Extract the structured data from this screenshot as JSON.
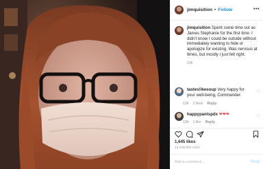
{
  "post": {
    "username": "jimquisition",
    "separator": "•",
    "follow_label": "Follow",
    "more_label": "•••",
    "caption_text": "Spent some time out as James Stephanie for the first time. I didn't know I could be outside without immediately wanting to hide or apologize for existing. Was nervous at times, but mostly I just felt right.",
    "caption_time": "13h",
    "likes": "1,645 likes",
    "posted_ago": "13 HOURS AGO"
  },
  "comments": [
    {
      "username": "tastes!ikesoup",
      "text": "Very happy for your well-being, Commander.",
      "time": "13h",
      "likes": "2 likes",
      "reply_label": "Reply",
      "hearts": ""
    },
    {
      "username": "happypantspdx",
      "text": "",
      "time": "13h",
      "likes": "1 like",
      "reply_label": "Reply",
      "hearts": "❤❤❤"
    }
  ],
  "composer": {
    "placeholder": "Add a comment...",
    "post_label": "Post"
  },
  "icons": {
    "like": "heart-icon",
    "comment": "comment-icon",
    "share": "share-icon",
    "save": "bookmark-icon"
  },
  "colors": {
    "accent": "#0095f6",
    "muted": "#8e8e8e",
    "heart_red": "#ed4956"
  }
}
